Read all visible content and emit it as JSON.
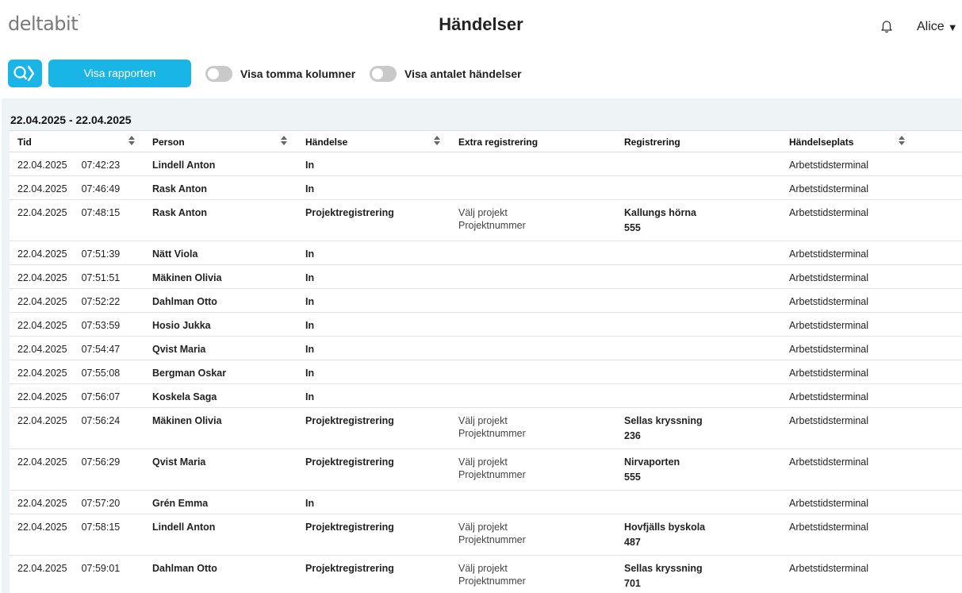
{
  "app": {
    "logo": "deltabit",
    "title": "Händelser",
    "user": "Alice"
  },
  "toolbar": {
    "report_label": "Visa rapporten",
    "toggle_empty_label": "Visa tomma kolumner",
    "toggle_count_label": "Visa antalet händelser"
  },
  "report": {
    "date_range": "22.04.2025 - 22.04.2025",
    "columns": [
      "Tid",
      "Person",
      "Händelse",
      "Extra registrering",
      "Registrering",
      "Händelseplats"
    ],
    "rows": [
      {
        "date": "22.04.2025",
        "time": "07:42:23",
        "person": "Lindell Anton",
        "event": "In",
        "extra": [
          "",
          ""
        ],
        "reg": [
          "",
          ""
        ],
        "place": "Arbetstidsterminal"
      },
      {
        "date": "22.04.2025",
        "time": "07:46:49",
        "person": "Rask Anton",
        "event": "In",
        "extra": [
          "",
          ""
        ],
        "reg": [
          "",
          ""
        ],
        "place": "Arbetstidsterminal"
      },
      {
        "date": "22.04.2025",
        "time": "07:48:15",
        "person": "Rask Anton",
        "event": "Projektregistrering",
        "extra": [
          "Välj projekt",
          "Projektnummer"
        ],
        "reg": [
          "Kallungs hörna",
          "555"
        ],
        "place": "Arbetstidsterminal"
      },
      {
        "date": "22.04.2025",
        "time": "07:51:39",
        "person": "Nätt Viola",
        "event": "In",
        "extra": [
          "",
          ""
        ],
        "reg": [
          "",
          ""
        ],
        "place": "Arbetstidsterminal"
      },
      {
        "date": "22.04.2025",
        "time": "07:51:51",
        "person": "Mäkinen Olivia",
        "event": "In",
        "extra": [
          "",
          ""
        ],
        "reg": [
          "",
          ""
        ],
        "place": "Arbetstidsterminal"
      },
      {
        "date": "22.04.2025",
        "time": "07:52:22",
        "person": "Dahlman Otto",
        "event": "In",
        "extra": [
          "",
          ""
        ],
        "reg": [
          "",
          ""
        ],
        "place": "Arbetstidsterminal"
      },
      {
        "date": "22.04.2025",
        "time": "07:53:59",
        "person": "Hosio Jukka",
        "event": "In",
        "extra": [
          "",
          ""
        ],
        "reg": [
          "",
          ""
        ],
        "place": "Arbetstidsterminal"
      },
      {
        "date": "22.04.2025",
        "time": "07:54:47",
        "person": "Qvist Maria",
        "event": "In",
        "extra": [
          "",
          ""
        ],
        "reg": [
          "",
          ""
        ],
        "place": "Arbetstidsterminal"
      },
      {
        "date": "22.04.2025",
        "time": "07:55:08",
        "person": "Bergman Oskar",
        "event": "In",
        "extra": [
          "",
          ""
        ],
        "reg": [
          "",
          ""
        ],
        "place": "Arbetstidsterminal"
      },
      {
        "date": "22.04.2025",
        "time": "07:56:07",
        "person": "Koskela Saga",
        "event": "In",
        "extra": [
          "",
          ""
        ],
        "reg": [
          "",
          ""
        ],
        "place": "Arbetstidsterminal"
      },
      {
        "date": "22.04.2025",
        "time": "07:56:24",
        "person": "Mäkinen Olivia",
        "event": "Projektregistrering",
        "extra": [
          "Välj projekt",
          "Projektnummer"
        ],
        "reg": [
          "Sellas kryssning",
          "236"
        ],
        "place": "Arbetstidsterminal"
      },
      {
        "date": "22.04.2025",
        "time": "07:56:29",
        "person": "Qvist Maria",
        "event": "Projektregistrering",
        "extra": [
          "Välj projekt",
          "Projektnummer"
        ],
        "reg": [
          "Nirvaporten",
          "555"
        ],
        "place": "Arbetstidsterminal"
      },
      {
        "date": "22.04.2025",
        "time": "07:57:20",
        "person": "Grén Emma",
        "event": "In",
        "extra": [
          "",
          ""
        ],
        "reg": [
          "",
          ""
        ],
        "place": "Arbetstidsterminal"
      },
      {
        "date": "22.04.2025",
        "time": "07:58:15",
        "person": "Lindell Anton",
        "event": "Projektregistrering",
        "extra": [
          "Välj projekt",
          "Projektnummer"
        ],
        "reg": [
          "Hovfjälls byskola",
          "487"
        ],
        "place": "Arbetstidsterminal"
      },
      {
        "date": "22.04.2025",
        "time": "07:59:01",
        "person": "Dahlman Otto",
        "event": "Projektregistrering",
        "extra": [
          "Välj projekt",
          "Projektnummer"
        ],
        "reg": [
          "Sellas kryssning",
          "701"
        ],
        "place": "Arbetstidsterminal"
      }
    ]
  },
  "colors": {
    "accent": "#19b5e6",
    "panel_bg": "#eef4f6",
    "toggle_off": "#c9c9c9"
  }
}
